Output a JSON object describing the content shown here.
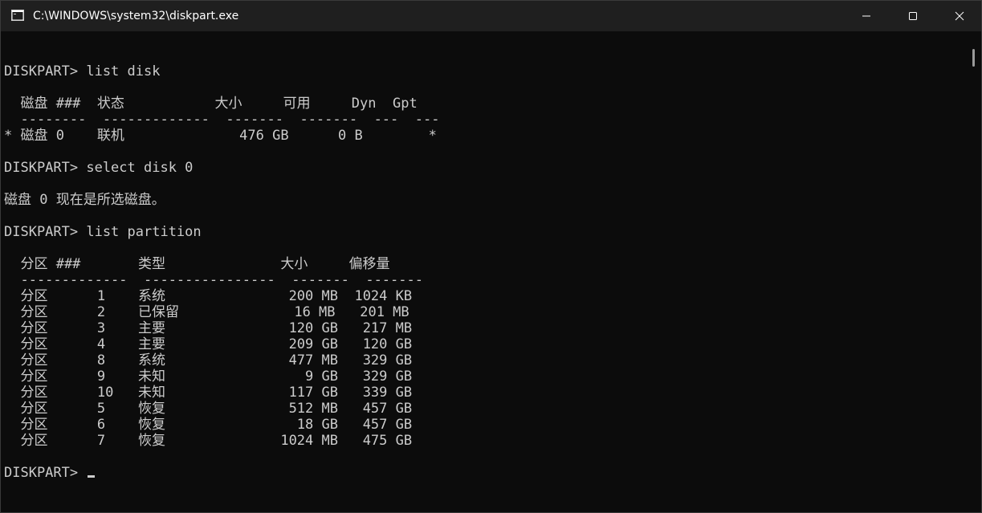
{
  "window": {
    "title": "C:\\WINDOWS\\system32\\diskpart.exe",
    "icon": "console-app-icon",
    "controls": {
      "minimize": "minimize-icon",
      "maximize": "maximize-icon",
      "close": "close-icon"
    }
  },
  "console": {
    "lines": [
      "",
      "DISKPART> list disk",
      "",
      "  磁盘 ###  状态           大小     可用     Dyn  Gpt",
      "  --------  -------------  -------  -------  ---  ---",
      "* 磁盘 0    联机              476 GB      0 B        *",
      "",
      "DISKPART> select disk 0",
      "",
      "磁盘 0 现在是所选磁盘。",
      "",
      "DISKPART> list partition",
      "",
      "  分区 ###       类型              大小     偏移量",
      "  -------------  ----------------  -------  -------",
      "  分区      1    系统               200 MB  1024 KB",
      "  分区      2    已保留              16 MB   201 MB",
      "  分区      3    主要               120 GB   217 MB",
      "  分区      4    主要               209 GB   120 GB",
      "  分区      8    系统               477 MB   329 GB",
      "  分区      9    未知                 9 GB   329 GB",
      "  分区      10   未知               117 GB   339 GB",
      "  分区      5    恢复               512 MB   457 GB",
      "  分区      6    恢复                18 GB   457 GB",
      "  分区      7    恢复              1024 MB   475 GB",
      "",
      "DISKPART> "
    ]
  },
  "colors": {
    "background": "#0c0c0c",
    "titlebar": "#1f1f1f",
    "text": "#cccccc"
  }
}
